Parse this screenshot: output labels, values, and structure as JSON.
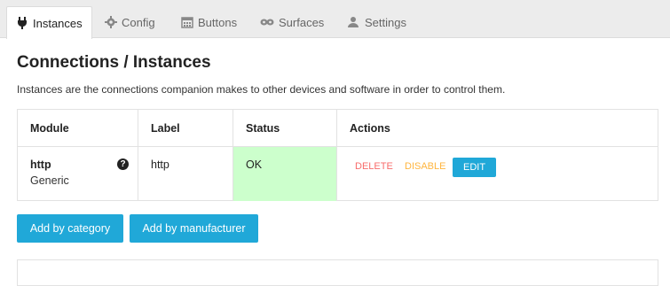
{
  "tabs": [
    {
      "label": "Instances",
      "icon": "plug-icon",
      "active": true
    },
    {
      "label": "Config",
      "icon": "cog-icon",
      "active": false
    },
    {
      "label": "Buttons",
      "icon": "calendar-grid-icon",
      "active": false
    },
    {
      "label": "Surfaces",
      "icon": "gamepad-icon",
      "active": false
    },
    {
      "label": "Settings",
      "icon": "user-settings-icon",
      "active": false
    }
  ],
  "page": {
    "title": "Connections / Instances",
    "description": "Instances are the connections companion makes to other devices and software in order to control them."
  },
  "table": {
    "headers": [
      "Module",
      "Label",
      "Status",
      "Actions"
    ],
    "rows": [
      {
        "module": "http",
        "module_sub": "Generic",
        "label": "http",
        "status": "OK",
        "actions": {
          "delete": "DELETE",
          "disable": "DISABLE",
          "edit": "EDIT"
        }
      }
    ]
  },
  "buttons": {
    "add_by_category": "Add by category",
    "add_by_manufacturer": "Add by manufacturer"
  },
  "help_glyph": "?",
  "colors": {
    "accent": "#20a8d8",
    "status_ok_bg": "#ccffcc",
    "delete": "#f86c6b",
    "disable": "#ffb53e"
  }
}
